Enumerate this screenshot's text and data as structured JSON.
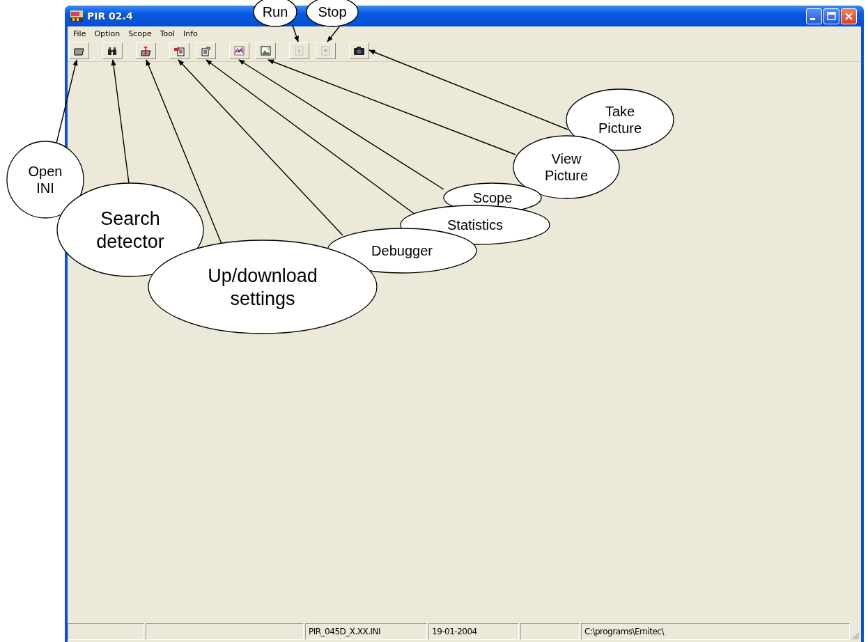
{
  "window": {
    "title": "PIR 02.4"
  },
  "menu": [
    "File",
    "Option",
    "Scope",
    "Tool",
    "Info"
  ],
  "toolbar": [
    {
      "buttons": [
        {
          "kind": "open",
          "disabled": false
        }
      ]
    },
    {
      "buttons": [
        {
          "kind": "search",
          "disabled": false
        }
      ]
    },
    {
      "buttons": [
        {
          "kind": "transfer",
          "disabled": false
        }
      ]
    },
    {
      "buttons": [
        {
          "kind": "debug",
          "disabled": false
        },
        {
          "kind": "statistics",
          "disabled": false
        }
      ]
    },
    {
      "buttons": [
        {
          "kind": "scope",
          "disabled": false
        },
        {
          "kind": "picture",
          "disabled": false
        }
      ]
    },
    {
      "buttons": [
        {
          "kind": "run",
          "disabled": true
        },
        {
          "kind": "stop",
          "disabled": true
        }
      ]
    },
    {
      "buttons": [
        {
          "kind": "camera",
          "disabled": false
        }
      ]
    }
  ],
  "status_bar": [
    "PIR_045D_X.XX.INI",
    "19-01-2004",
    "C:\\programs\\Ernitec\\"
  ],
  "annotations": [
    {
      "lines": [
        "Run"
      ]
    },
    {
      "lines": [
        "Stop"
      ]
    },
    {
      "lines": [
        "Take",
        "Picture"
      ]
    },
    {
      "lines": [
        "View",
        "Picture"
      ]
    },
    {
      "lines": [
        "Open",
        "INI"
      ]
    },
    {
      "lines": [
        "Scope"
      ]
    },
    {
      "lines": [
        "Statistics"
      ]
    },
    {
      "lines": [
        "Search",
        "detector"
      ]
    },
    {
      "lines": [
        "Debugger"
      ]
    },
    {
      "lines": [
        "Up/download",
        "settings"
      ]
    }
  ]
}
